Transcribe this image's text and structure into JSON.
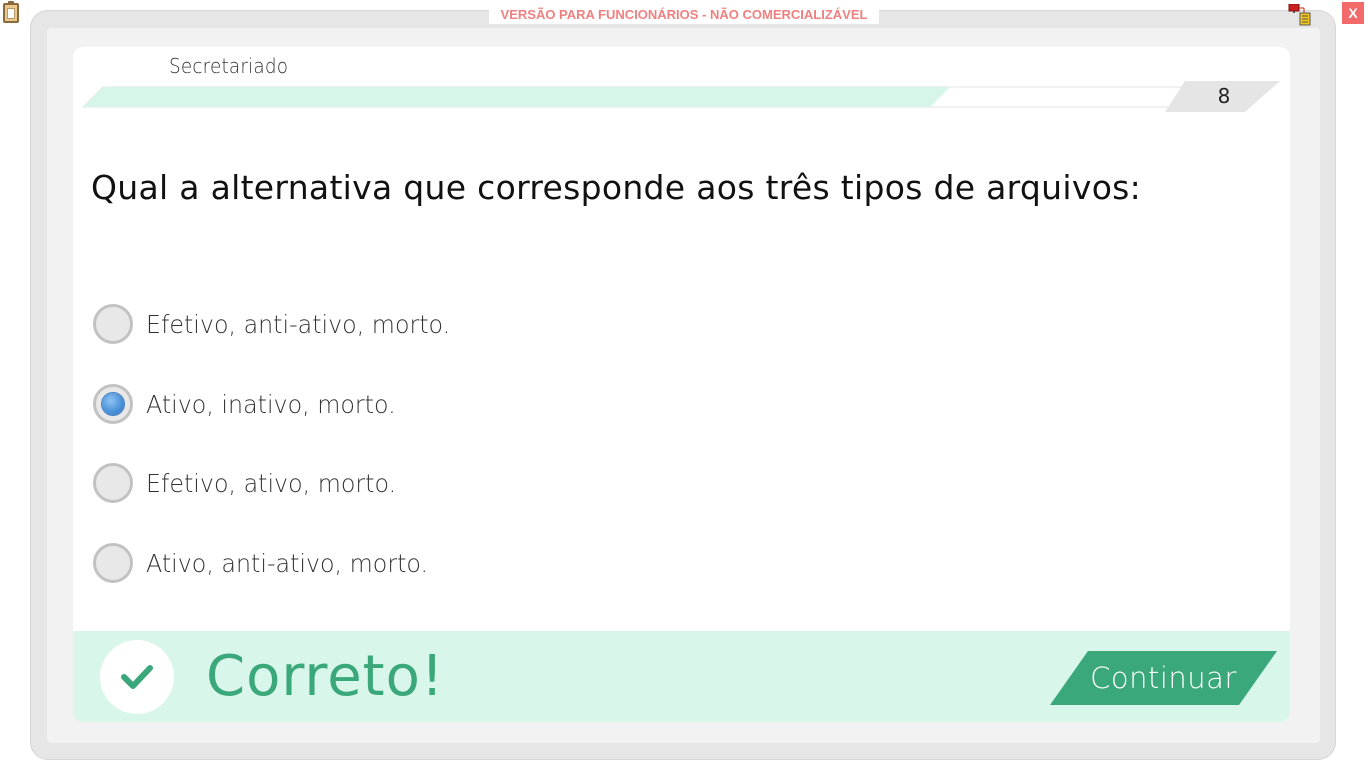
{
  "watermark": "VERSÃO PARA FUNCIONÁRIOS - NÃO COMERCIALIZÁVEL",
  "window": {
    "close_label": "X"
  },
  "icons": {
    "clipboard": "clipboard-icon",
    "network": "network-status-icon",
    "check": "checkmark-icon"
  },
  "header": {
    "subject": "Secretariado",
    "progress_fraction": 0.78,
    "question_number": "8"
  },
  "question": {
    "text": "Qual a alternativa que corresponde aos três tipos de arquivos:",
    "options": [
      {
        "label": "Efetivo, anti-ativo, morto.",
        "selected": false
      },
      {
        "label": "Ativo, inativo, morto.",
        "selected": true
      },
      {
        "label": "Efetivo, ativo, morto.",
        "selected": false
      },
      {
        "label": "Ativo, anti-ativo, morto.",
        "selected": false
      }
    ]
  },
  "feedback": {
    "status_text": "Correto!",
    "continue_label": "Continuar"
  },
  "colors": {
    "accent_green": "#3aa87a",
    "feedback_bg": "#d9f6ea",
    "progress_fill": "#d6f6ea",
    "selected_radio": "#4d93d9",
    "close_red": "#f36a6a",
    "watermark_text": "#f08080"
  }
}
